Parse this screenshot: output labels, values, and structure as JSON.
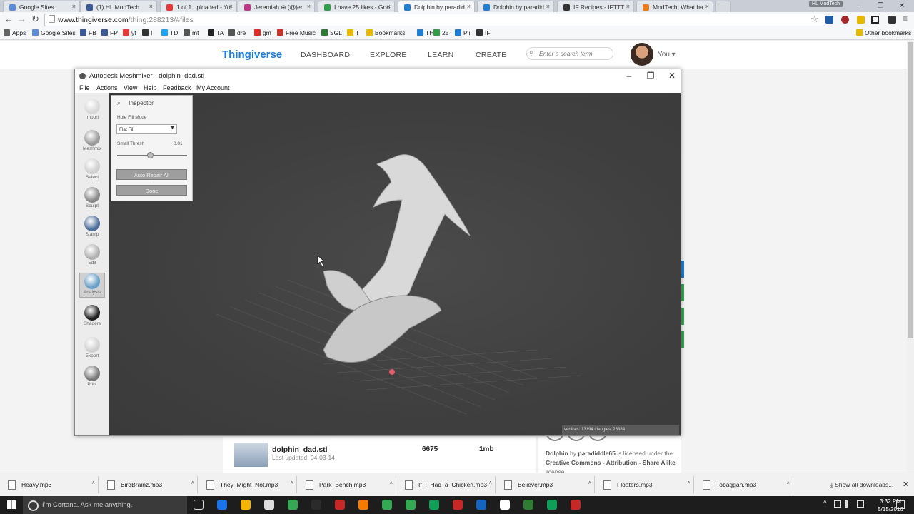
{
  "tabs": [
    {
      "label": "Google Sites",
      "color": "#5b8ddc"
    },
    {
      "label": "(1) HL ModTech",
      "color": "#3b5998"
    },
    {
      "label": "1 of 1 uploaded - Yo",
      "color": "#e53935"
    },
    {
      "label": "Jeremiah ⊕ (@jer",
      "color": "#c13584"
    },
    {
      "label": "I have 25 likes - Goo",
      "color": "#2e9e49"
    },
    {
      "label": "Dolphin by paradid",
      "color": "#1f7ed6"
    },
    {
      "label": "Dolphin by paradid",
      "color": "#1f7ed6"
    },
    {
      "label": "IF Recipes - IFTTT",
      "color": "#333333"
    },
    {
      "label": "ModTech: What ha",
      "color": "#e67e22"
    }
  ],
  "profile_badge": "HL ModTech",
  "window_controls": [
    "–",
    "❐",
    "✕"
  ],
  "address": {
    "host": "www.thingiverse.com",
    "path": "/thing:288213/#files"
  },
  "bookmarks": [
    {
      "label": "Apps",
      "color": "#666"
    },
    {
      "label": "Google Sites",
      "color": "#5b8ddc"
    },
    {
      "label": "FB",
      "color": "#3b5998"
    },
    {
      "label": "FP",
      "color": "#3b5998"
    },
    {
      "label": "yt",
      "color": "#e53935"
    },
    {
      "label": "I",
      "color": "#333"
    },
    {
      "label": "TD",
      "color": "#1da1f2"
    },
    {
      "label": "mt",
      "color": "#555"
    },
    {
      "label": "TA",
      "color": "#222"
    },
    {
      "label": "dre",
      "color": "#555"
    },
    {
      "label": "gm",
      "color": "#d93025"
    },
    {
      "label": "Free Music",
      "color": "#c0392b"
    },
    {
      "label": "SGL",
      "color": "#2e7d32"
    },
    {
      "label": "T",
      "color": "#e6b800"
    },
    {
      "label": "Bookmarks",
      "color": "#e6b800"
    },
    {
      "label": "TH",
      "color": "#1f7ed6"
    },
    {
      "label": "25",
      "color": "#2e9e49"
    },
    {
      "label": "Pli",
      "color": "#1f7ed6"
    },
    {
      "label": "IF",
      "color": "#333"
    }
  ],
  "other_bookmarks": "Other bookmarks",
  "site": {
    "logo": "Thingiverse",
    "nav": [
      "DASHBOARD",
      "EXPLORE",
      "LEARN",
      "CREATE"
    ],
    "search_placeholder": "Enter a search term",
    "user": "You"
  },
  "meshmixer": {
    "title": "Autodesk Meshmixer - dolphin_dad.stl",
    "menu": [
      "File",
      "Actions",
      "View",
      "Help",
      "Feedback",
      "My Account"
    ],
    "tools": [
      "Import",
      "Meshmix",
      "Select",
      "Sculpt",
      "Stamp",
      "Edit",
      "Analysis",
      "Shaders",
      "Export",
      "Print"
    ],
    "inspector": {
      "title": "Inspector",
      "hole_fill_label": "Hole Fill Mode",
      "hole_fill_value": "Flat Fill",
      "thresh_label": "Small Thresh",
      "thresh_value": "0.01",
      "thresh_level": 0.47,
      "repair_button": "Auto Repair All",
      "done_button": "Done"
    },
    "status": "vertices: 13194 triangles: 26384"
  },
  "file": {
    "name": "dolphin_dad.stl",
    "updated": "Last updated: 04-03-14",
    "count": "6675",
    "size": "1mb"
  },
  "license": {
    "thing": "Dolphin",
    "by": "by",
    "author": "paradiddle65",
    "text": "is licensed under the",
    "license_name": "Creative Commons - Attribution - Share Alike",
    "suffix": "license."
  },
  "downloads": [
    "Heavy.mp3",
    "BirdBrainz.mp3",
    "They_Might_Not.mp3",
    "Park_Bench.mp3",
    "If_I_Had_a_Chicken.mp3",
    "Believer.mp3",
    "Floaters.mp3",
    "Tobaggan.mp3"
  ],
  "show_all": "Show all downloads...",
  "taskbar": {
    "cortana": "I'm Cortana. Ask me anything.",
    "time": "3:32 PM",
    "date": "5/15/2016"
  }
}
